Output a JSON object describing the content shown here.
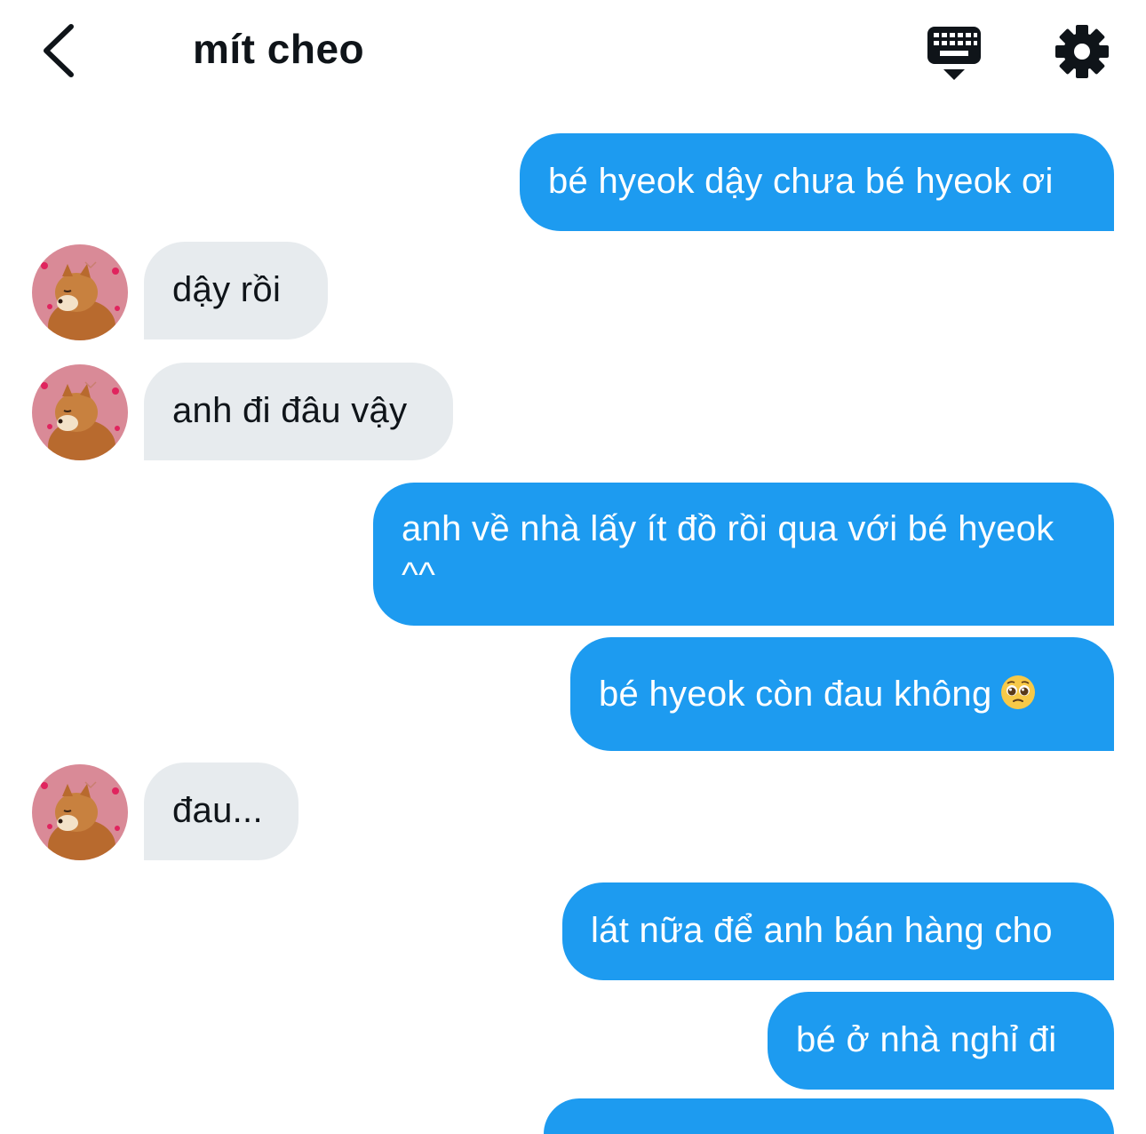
{
  "header": {
    "title": "mít cheo",
    "back_icon": "chevron-left-icon",
    "keyboard_icon": "keyboard-icon",
    "settings_icon": "gear-icon"
  },
  "colors": {
    "outgoing_bubble": "#1d9bf0",
    "incoming_bubble": "#e7ebee",
    "text_dark": "#0f1419"
  },
  "messages": [
    {
      "side": "out",
      "text": "bé hyeok dậy chưa bé hyeok ơi"
    },
    {
      "side": "in",
      "text": "dậy rồi"
    },
    {
      "side": "in",
      "text": "anh đi đâu vậy"
    },
    {
      "side": "out",
      "text": "anh về nhà lấy ít đồ rồi qua với bé hyeok ^^"
    },
    {
      "side": "out",
      "text": "bé hyeok còn đau không",
      "emoji": "pleading-face-icon"
    },
    {
      "side": "in",
      "text": "đau..."
    },
    {
      "side": "out",
      "text": "lát nữa để anh bán hàng cho"
    },
    {
      "side": "out",
      "text": "bé ở nhà nghỉ đi"
    }
  ]
}
